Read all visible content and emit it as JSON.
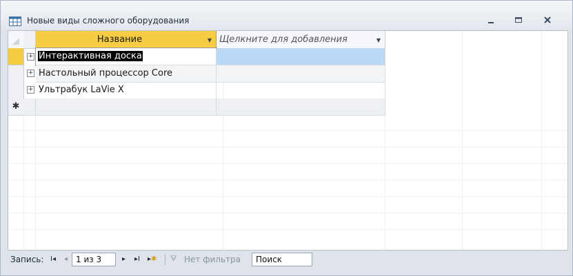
{
  "window": {
    "title": "Новые виды сложного оборудования",
    "icon": "table-icon",
    "controls": [
      "minimize-icon",
      "restore-icon",
      "close-icon"
    ]
  },
  "table": {
    "columns": [
      {
        "label": "Название",
        "selected": true
      },
      {
        "label": "Щелкните для добавления",
        "placeholder_column": true
      }
    ],
    "rows": [
      {
        "name": "Интерактивная доска",
        "current": true
      },
      {
        "name": "Настольный процессор Core"
      },
      {
        "name": "Ультрабук LaVie X"
      }
    ],
    "new_record_marker": "✱"
  },
  "navigator": {
    "record_label": "Запись:",
    "position": "1 из 3",
    "filter_label": "Нет фильтра",
    "search_label": "Поиск"
  },
  "colors": {
    "selected_header": "#f5cc42",
    "highlight_cell": "#bcd8f7"
  }
}
